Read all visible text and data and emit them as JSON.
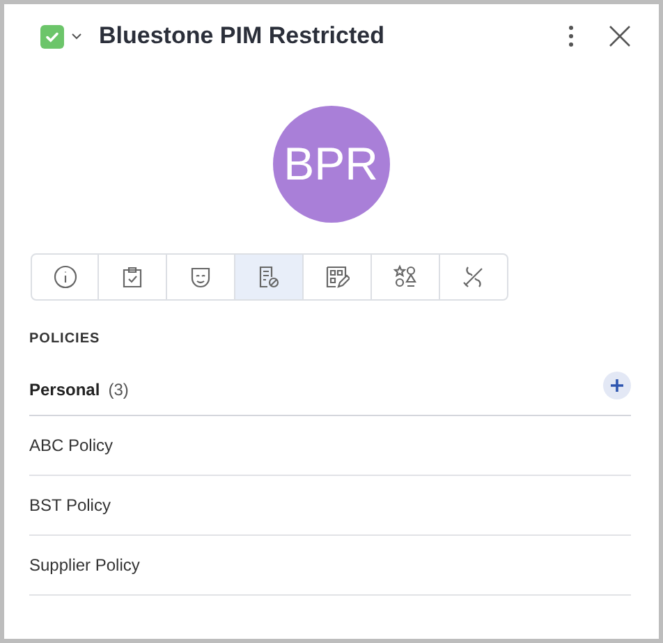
{
  "header": {
    "checked": true,
    "title": "Bluestone PIM Restricted"
  },
  "avatar": {
    "initials": "BPR"
  },
  "tabs": [
    {
      "kind": "info",
      "selected": false
    },
    {
      "kind": "clipboard",
      "selected": false
    },
    {
      "kind": "mask",
      "selected": false
    },
    {
      "kind": "policy",
      "selected": true
    },
    {
      "kind": "form",
      "selected": false
    },
    {
      "kind": "shapes",
      "selected": false
    },
    {
      "kind": "tools",
      "selected": false
    }
  ],
  "section": {
    "title": "POLICIES",
    "group": {
      "label": "Personal",
      "count": "(3)"
    },
    "items": [
      {
        "name": "ABC Policy"
      },
      {
        "name": "BST Policy"
      },
      {
        "name": "Supplier Policy"
      }
    ]
  }
}
